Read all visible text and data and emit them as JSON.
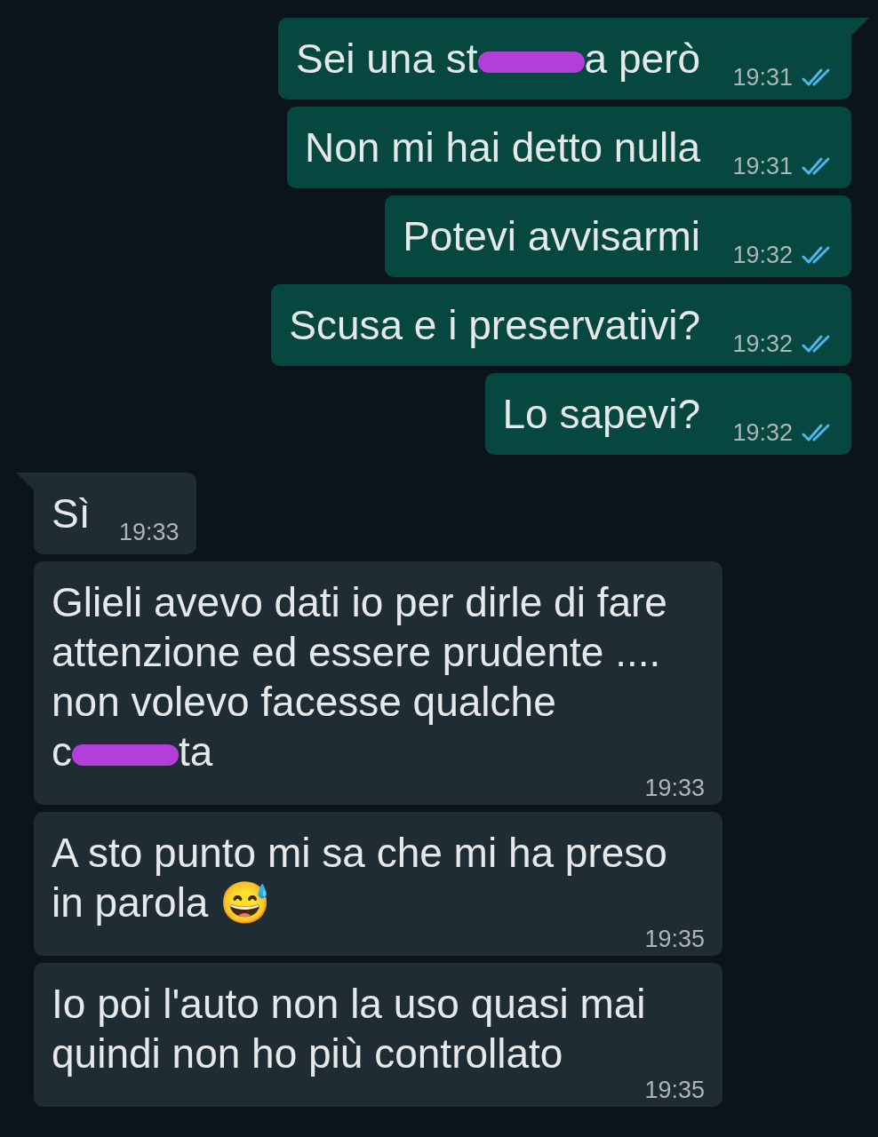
{
  "messages": [
    {
      "kind": "sent",
      "tail": true,
      "parts": [
        {
          "kind": "text",
          "text": "Sei una st"
        },
        {
          "kind": "redaction"
        },
        {
          "kind": "text",
          "text": "a però"
        }
      ],
      "time": "19:31",
      "read": true
    },
    {
      "kind": "sent",
      "tail": false,
      "parts": [
        {
          "kind": "text",
          "text": "Non mi hai detto nulla"
        }
      ],
      "time": "19:31",
      "read": true
    },
    {
      "kind": "sent",
      "tail": false,
      "parts": [
        {
          "kind": "text",
          "text": "Potevi avvisarmi"
        }
      ],
      "time": "19:32",
      "read": true
    },
    {
      "kind": "sent",
      "tail": false,
      "parts": [
        {
          "kind": "text",
          "text": "Scusa e i preservativi?"
        }
      ],
      "time": "19:32",
      "read": true
    },
    {
      "kind": "sent",
      "tail": false,
      "parts": [
        {
          "kind": "text",
          "text": "Lo sapevi?"
        }
      ],
      "time": "19:32",
      "read": true
    },
    {
      "kind": "received",
      "tail": true,
      "parts": [
        {
          "kind": "text",
          "text": "Sì"
        }
      ],
      "time": "19:33"
    },
    {
      "kind": "received",
      "tail": false,
      "parts": [
        {
          "kind": "text",
          "text": "Glieli avevo dati io per dirle di fare attenzione ed essere prudente .... non volevo facesse qualche"
        },
        {
          "kind": "text",
          "text": "c"
        },
        {
          "kind": "redaction"
        },
        {
          "kind": "text",
          "text": "ta"
        }
      ],
      "time": "19:33"
    },
    {
      "kind": "received",
      "tail": false,
      "parts": [
        {
          "kind": "text",
          "text": "A sto punto mi sa che mi ha preso in parola 😅"
        }
      ],
      "time": "19:35"
    },
    {
      "kind": "received",
      "tail": false,
      "parts": [
        {
          "kind": "text",
          "text": "Io poi l'auto non la uso quasi mai quindi non ho più controllato"
        }
      ],
      "time": "19:35"
    }
  ]
}
